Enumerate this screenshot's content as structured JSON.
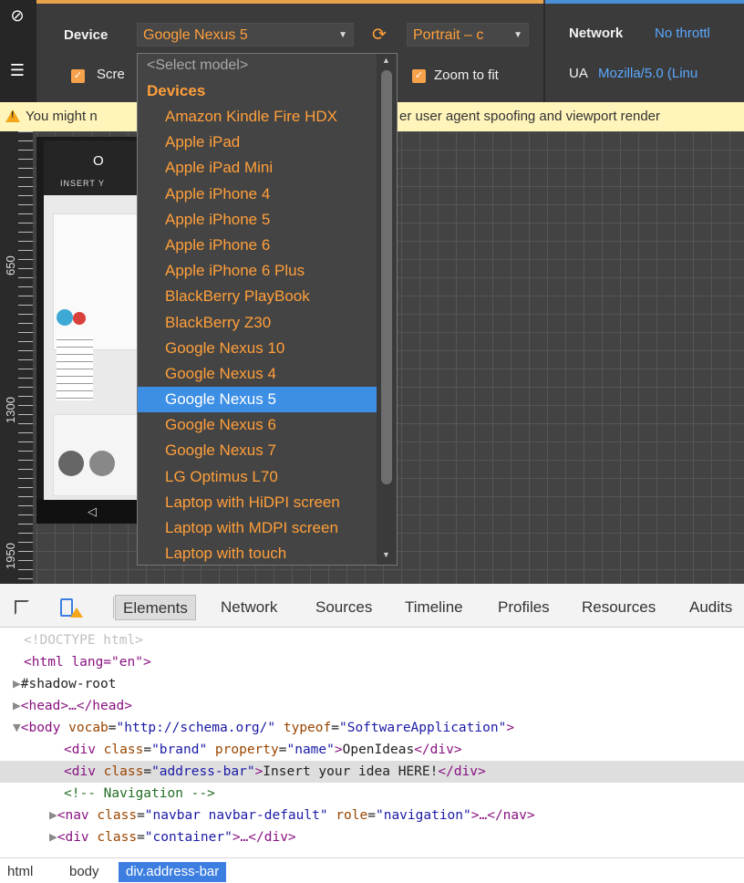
{
  "emulation": {
    "device_label": "Device",
    "device_selected": "Google Nexus 5",
    "orientation": "Portrait – c",
    "screen_label": "Scre",
    "zoom_label": "Zoom to fit",
    "network_label": "Network",
    "network_value": "No throttl",
    "ua_label": "UA",
    "ua_value": "Mozilla/5.0 (Linu"
  },
  "warning": {
    "prefix": "You might n",
    "suffix": "er user agent spoofing and viewport render"
  },
  "preview": {
    "title": "O",
    "subtitle": "INSERT Y",
    "nav_back": "◁",
    "ruler_labels": [
      "650",
      "1300",
      "1950"
    ]
  },
  "dropdown": {
    "placeholder": "<Select model>",
    "group": "Devices",
    "items": [
      "Amazon Kindle Fire HDX",
      "Apple iPad",
      "Apple iPad Mini",
      "Apple iPhone 4",
      "Apple iPhone 5",
      "Apple iPhone 6",
      "Apple iPhone 6 Plus",
      "BlackBerry PlayBook",
      "BlackBerry Z30",
      "Google Nexus 10",
      "Google Nexus 4",
      "Google Nexus 5",
      "Google Nexus 6",
      "Google Nexus 7",
      "LG Optimus L70",
      "Laptop with HiDPI screen",
      "Laptop with MDPI screen",
      "Laptop with touch"
    ],
    "selected": "Google Nexus 5"
  },
  "tabs": [
    "Elements",
    "Network",
    "Sources",
    "Timeline",
    "Profiles",
    "Resources",
    "Audits"
  ],
  "code": {
    "doctype": "<!DOCTYPE html>",
    "html_open": "<html lang=\"en\">",
    "shadow_root": "#shadow-root",
    "head": "<head>…</head>",
    "body_tag": "body",
    "body_attr1": "vocab",
    "body_val1": "\"http://schema.org/\"",
    "body_attr2": "typeof",
    "body_val2": "\"SoftwareApplication\"",
    "brand_tag": "div",
    "brand_attr1": "class",
    "brand_val1": "\"brand\"",
    "brand_attr2": "property",
    "brand_val2": "\"name\"",
    "brand_text": "OpenIdeas",
    "addr_tag": "div",
    "addr_attr": "class",
    "addr_val": "\"address-bar\"",
    "addr_text": "Insert your idea HERE!",
    "comment": "<!-- Navigation -->",
    "nav_tag": "nav",
    "nav_attr1": "class",
    "nav_val1": "\"navbar navbar-default\"",
    "nav_attr2": "role",
    "nav_val2": "\"navigation\"",
    "container_tag": "div",
    "container_attr": "class",
    "container_val": "\"container\""
  },
  "breadcrumbs": [
    "html",
    "body",
    "div.address-bar"
  ],
  "colors": {
    "accent_orange": "#ff9f3a",
    "selection_blue": "#3d8fe5",
    "tag_purple": "#881280"
  }
}
